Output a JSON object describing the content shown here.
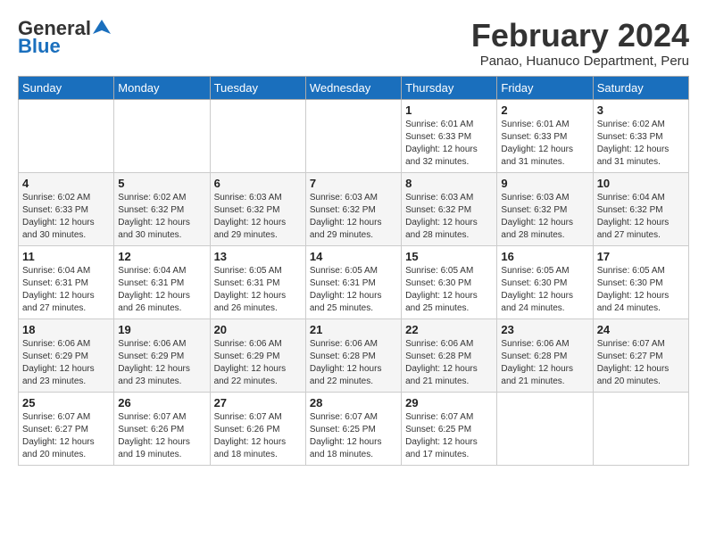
{
  "header": {
    "logo_general": "General",
    "logo_blue": "Blue",
    "month_title": "February 2024",
    "subtitle": "Panao, Huanuco Department, Peru"
  },
  "days_of_week": [
    "Sunday",
    "Monday",
    "Tuesday",
    "Wednesday",
    "Thursday",
    "Friday",
    "Saturday"
  ],
  "weeks": [
    [
      {
        "day": "",
        "info": ""
      },
      {
        "day": "",
        "info": ""
      },
      {
        "day": "",
        "info": ""
      },
      {
        "day": "",
        "info": ""
      },
      {
        "day": "1",
        "info": "Sunrise: 6:01 AM\nSunset: 6:33 PM\nDaylight: 12 hours\nand 32 minutes."
      },
      {
        "day": "2",
        "info": "Sunrise: 6:01 AM\nSunset: 6:33 PM\nDaylight: 12 hours\nand 31 minutes."
      },
      {
        "day": "3",
        "info": "Sunrise: 6:02 AM\nSunset: 6:33 PM\nDaylight: 12 hours\nand 31 minutes."
      }
    ],
    [
      {
        "day": "4",
        "info": "Sunrise: 6:02 AM\nSunset: 6:33 PM\nDaylight: 12 hours\nand 30 minutes."
      },
      {
        "day": "5",
        "info": "Sunrise: 6:02 AM\nSunset: 6:32 PM\nDaylight: 12 hours\nand 30 minutes."
      },
      {
        "day": "6",
        "info": "Sunrise: 6:03 AM\nSunset: 6:32 PM\nDaylight: 12 hours\nand 29 minutes."
      },
      {
        "day": "7",
        "info": "Sunrise: 6:03 AM\nSunset: 6:32 PM\nDaylight: 12 hours\nand 29 minutes."
      },
      {
        "day": "8",
        "info": "Sunrise: 6:03 AM\nSunset: 6:32 PM\nDaylight: 12 hours\nand 28 minutes."
      },
      {
        "day": "9",
        "info": "Sunrise: 6:03 AM\nSunset: 6:32 PM\nDaylight: 12 hours\nand 28 minutes."
      },
      {
        "day": "10",
        "info": "Sunrise: 6:04 AM\nSunset: 6:32 PM\nDaylight: 12 hours\nand 27 minutes."
      }
    ],
    [
      {
        "day": "11",
        "info": "Sunrise: 6:04 AM\nSunset: 6:31 PM\nDaylight: 12 hours\nand 27 minutes."
      },
      {
        "day": "12",
        "info": "Sunrise: 6:04 AM\nSunset: 6:31 PM\nDaylight: 12 hours\nand 26 minutes."
      },
      {
        "day": "13",
        "info": "Sunrise: 6:05 AM\nSunset: 6:31 PM\nDaylight: 12 hours\nand 26 minutes."
      },
      {
        "day": "14",
        "info": "Sunrise: 6:05 AM\nSunset: 6:31 PM\nDaylight: 12 hours\nand 25 minutes."
      },
      {
        "day": "15",
        "info": "Sunrise: 6:05 AM\nSunset: 6:30 PM\nDaylight: 12 hours\nand 25 minutes."
      },
      {
        "day": "16",
        "info": "Sunrise: 6:05 AM\nSunset: 6:30 PM\nDaylight: 12 hours\nand 24 minutes."
      },
      {
        "day": "17",
        "info": "Sunrise: 6:05 AM\nSunset: 6:30 PM\nDaylight: 12 hours\nand 24 minutes."
      }
    ],
    [
      {
        "day": "18",
        "info": "Sunrise: 6:06 AM\nSunset: 6:29 PM\nDaylight: 12 hours\nand 23 minutes."
      },
      {
        "day": "19",
        "info": "Sunrise: 6:06 AM\nSunset: 6:29 PM\nDaylight: 12 hours\nand 23 minutes."
      },
      {
        "day": "20",
        "info": "Sunrise: 6:06 AM\nSunset: 6:29 PM\nDaylight: 12 hours\nand 22 minutes."
      },
      {
        "day": "21",
        "info": "Sunrise: 6:06 AM\nSunset: 6:28 PM\nDaylight: 12 hours\nand 22 minutes."
      },
      {
        "day": "22",
        "info": "Sunrise: 6:06 AM\nSunset: 6:28 PM\nDaylight: 12 hours\nand 21 minutes."
      },
      {
        "day": "23",
        "info": "Sunrise: 6:06 AM\nSunset: 6:28 PM\nDaylight: 12 hours\nand 21 minutes."
      },
      {
        "day": "24",
        "info": "Sunrise: 6:07 AM\nSunset: 6:27 PM\nDaylight: 12 hours\nand 20 minutes."
      }
    ],
    [
      {
        "day": "25",
        "info": "Sunrise: 6:07 AM\nSunset: 6:27 PM\nDaylight: 12 hours\nand 20 minutes."
      },
      {
        "day": "26",
        "info": "Sunrise: 6:07 AM\nSunset: 6:26 PM\nDaylight: 12 hours\nand 19 minutes."
      },
      {
        "day": "27",
        "info": "Sunrise: 6:07 AM\nSunset: 6:26 PM\nDaylight: 12 hours\nand 18 minutes."
      },
      {
        "day": "28",
        "info": "Sunrise: 6:07 AM\nSunset: 6:25 PM\nDaylight: 12 hours\nand 18 minutes."
      },
      {
        "day": "29",
        "info": "Sunrise: 6:07 AM\nSunset: 6:25 PM\nDaylight: 12 hours\nand 17 minutes."
      },
      {
        "day": "",
        "info": ""
      },
      {
        "day": "",
        "info": ""
      }
    ]
  ]
}
